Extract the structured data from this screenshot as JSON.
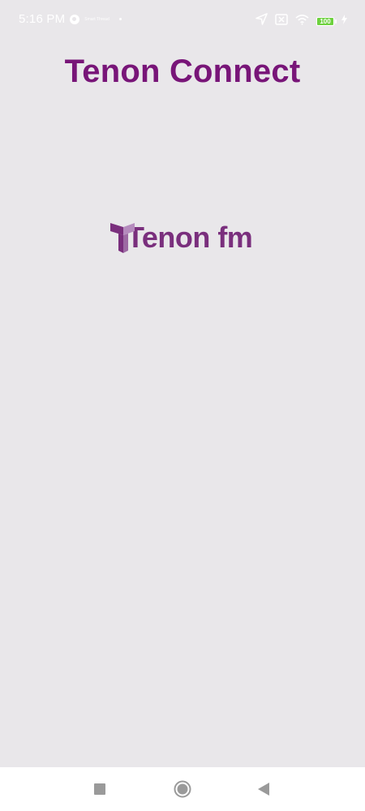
{
  "status_bar": {
    "time": "5:16 PM",
    "notification_text": "Smart Thread",
    "battery_level": "100",
    "icons": [
      "location-arrow-icon",
      "sim-off-icon",
      "wifi-icon",
      "battery-icon",
      "charging-bolt-icon"
    ]
  },
  "header": {
    "title": "Tenon Connect"
  },
  "logo": {
    "text": "Tenon fm",
    "colors": {
      "primary": "#7a2f7d",
      "accent": "#b58bbd"
    }
  },
  "nav_bar": {
    "buttons": [
      "recent-apps-button",
      "home-button",
      "back-button"
    ]
  },
  "colors": {
    "background": "#e9e7ea",
    "title": "#781578",
    "nav_background": "#ffffff",
    "nav_icon": "#9a9a9a",
    "battery_fill": "#6dd13e"
  }
}
